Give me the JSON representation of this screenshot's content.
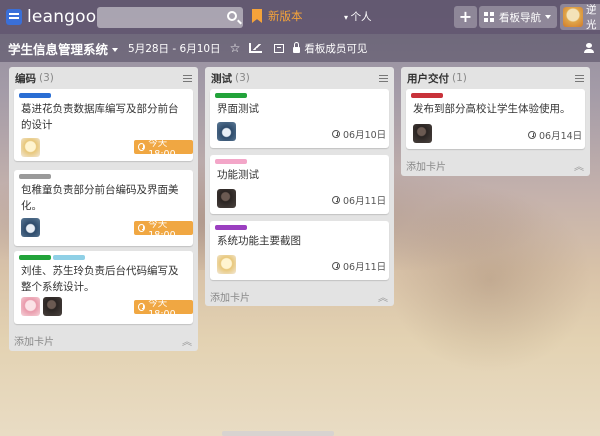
{
  "app": {
    "logo_text": "leangoo",
    "new_version": "新版本",
    "personal": "个人",
    "board_nav": "看板导航",
    "user_name": "逆光"
  },
  "board": {
    "title": "学生信息管理系统",
    "date_range": "5月28日 - 6月10日",
    "visibility": "看板成员可见"
  },
  "lists": [
    {
      "name": "编码",
      "count": "(3)",
      "add_card": "添加卡片",
      "cards": [
        {
          "labels": [
            "#2a6ed4"
          ],
          "text": "葛进花负责数据库编写及部分前台的设计",
          "due": "今天18:00",
          "due_style": "orange"
        },
        {
          "labels": [
            "#9a9a9a"
          ],
          "text": "包稚童负责部分前台编码及界面美化。",
          "due": "今天18:00",
          "due_style": "orange"
        },
        {
          "labels": [
            "#22a33a",
            "#8fd0e6"
          ],
          "text": "刘佳、苏生玲负责后台代码编写及整个系统设计。",
          "due": "今天18:00",
          "due_style": "orange"
        }
      ]
    },
    {
      "name": "测试",
      "count": "(3)",
      "add_card": "添加卡片",
      "cards": [
        {
          "labels": [
            "#22a33a"
          ],
          "text": "界面测试",
          "due": "06月10日",
          "due_style": "gray"
        },
        {
          "labels": [
            "#f3a6c8"
          ],
          "text": "功能测试",
          "due": "06月11日",
          "due_style": "gray"
        },
        {
          "labels": [
            "#9b3fc0"
          ],
          "text": "系统功能主要截图",
          "due": "06月11日",
          "due_style": "gray"
        }
      ]
    },
    {
      "name": "用户交付",
      "count": "(1)",
      "add_card": "添加卡片",
      "cards": [
        {
          "labels": [
            "#c8323a"
          ],
          "text": "发布到部分高校让学生体验使用。",
          "due": "06月14日",
          "due_style": "gray"
        }
      ]
    }
  ],
  "colors": {
    "due_orange": "#f0a742",
    "new_version": "#f5a33a",
    "topbar": "#5f556e"
  },
  "icons": [
    "search-icon",
    "bookmark-icon",
    "plus-icon",
    "grid-icon",
    "star-icon",
    "chart-icon",
    "archive-icon",
    "lock-icon",
    "person-icon",
    "menu-icon",
    "clock-icon",
    "collapse-icon"
  ]
}
